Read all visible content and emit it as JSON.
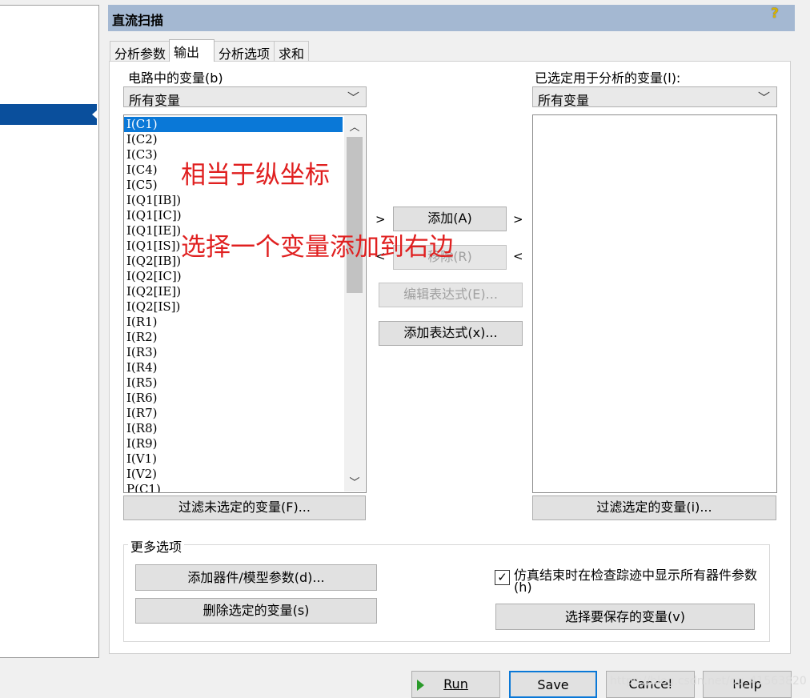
{
  "dialog": {
    "title": "直流扫描",
    "help_glyph": "?"
  },
  "tabs": [
    {
      "label": "分析参数",
      "active": false
    },
    {
      "label": "输出",
      "active": true
    },
    {
      "label": "分析选项",
      "active": false
    },
    {
      "label": "求和",
      "active": false
    }
  ],
  "left_column": {
    "label": "电路中的变量(b)",
    "filter_value": "所有变量",
    "variables": [
      "I(C1)",
      "I(C2)",
      "I(C3)",
      "I(C4)",
      "I(C5)",
      "I(Q1[IB])",
      "I(Q1[IC])",
      "I(Q1[IE])",
      "I(Q1[IS])",
      "I(Q2[IB])",
      "I(Q2[IC])",
      "I(Q2[IE])",
      "I(Q2[IS])",
      "I(R1)",
      "I(R2)",
      "I(R3)",
      "I(R4)",
      "I(R5)",
      "I(R6)",
      "I(R7)",
      "I(R8)",
      "I(R9)",
      "I(V1)",
      "I(V2)",
      "P(C1)"
    ],
    "selected_variable": "I(C1)",
    "filter_button": "过滤未选定的变量(F)..."
  },
  "right_column": {
    "label": "已选定用于分析的变量(l):",
    "filter_value": "所有变量",
    "variables": [],
    "filter_button": "过滤选定的变量(i)..."
  },
  "middle": {
    "add_button": "添加(A)",
    "remove_button": "移除(R)",
    "edit_expr_button": "编辑表达式(E)...",
    "add_expr_button": "添加表达式(x)...",
    "arrow_right": ">",
    "arrow_left": "<"
  },
  "more_options": {
    "legend": "更多选项",
    "add_param_button": "添加器件/模型参数(d)...",
    "delete_var_button": "删除选定的变量(s)",
    "checkbox_label": "仿真结束时在检查踪迹中显示所有器件参数",
    "checkbox_label_line2": "(h)",
    "checkbox_checked": true,
    "checkbox_mark": "✓",
    "save_vars_button": "选择要保存的变量(v)"
  },
  "annotations": {
    "line1": "相当于纵坐标",
    "line2": "选择一个变量添加到右边"
  },
  "footer": {
    "run": "Run",
    "save": "Save",
    "cancel": "Cancel",
    "help": "Help"
  },
  "watermark": "https://blog.csdn.net/qq_41563820",
  "colors": {
    "title_bar": "#a4b8d2",
    "selection": "#0a78d7",
    "annotation": "#e02020"
  }
}
